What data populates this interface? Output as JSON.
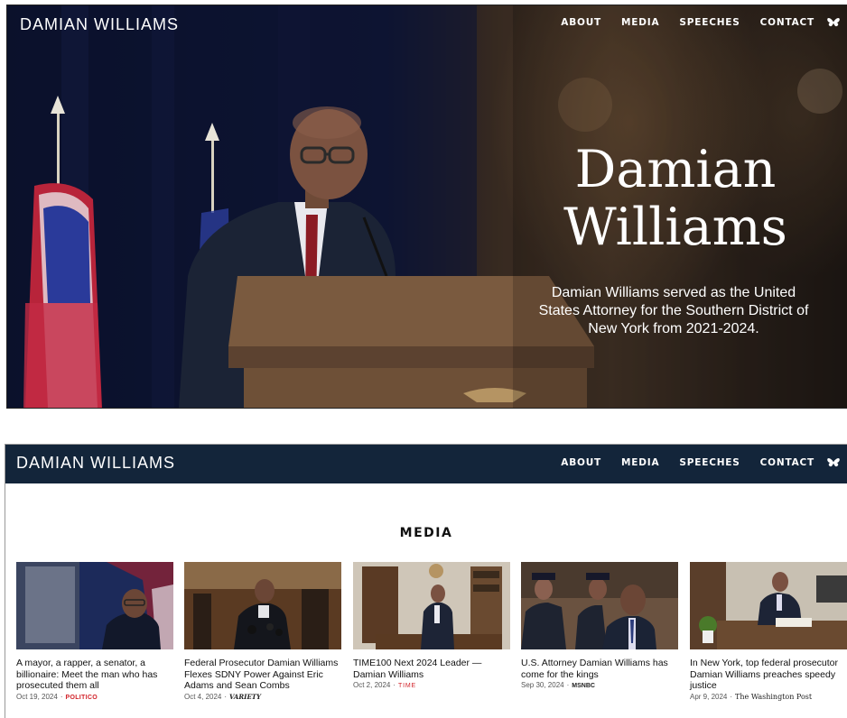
{
  "header": {
    "brand": "DAMIAN WILLIAMS",
    "nav": [
      "ABOUT",
      "MEDIA",
      "SPEECHES",
      "CONTACT"
    ],
    "social_icon": "butterfly-icon"
  },
  "hero": {
    "title_line1": "Damian",
    "title_line2": "Williams",
    "description": "Damian Williams served as the United States Attorney for the Southern District of New York from 2021-2024."
  },
  "media": {
    "heading": "MEDIA",
    "cards": [
      {
        "title": "A mayor, a rapper, a senator, a billionaire: Meet the man who has prosecuted them all",
        "date": "Oct 19, 2024",
        "source": "POLITICO"
      },
      {
        "title": "Federal Prosecutor Damian Williams Flexes SDNY Power Against Eric Adams and Sean Combs",
        "date": "Oct 4, 2024",
        "source": "VARIETY"
      },
      {
        "title": "TIME100 Next 2024 Leader — Damian Williams",
        "date": "Oct 2, 2024",
        "source": "TIME"
      },
      {
        "title": "U.S. Attorney Damian Williams has come for the kings",
        "date": "Sep 30, 2024",
        "source": "MSNBC"
      },
      {
        "title": "In New York, top federal prosecutor Damian Williams preaches speedy justice",
        "date": "Apr 9, 2024",
        "source": "The Washington Post"
      }
    ]
  },
  "colors": {
    "dark_nav": "#13253a",
    "source_red": "#d2232a"
  }
}
